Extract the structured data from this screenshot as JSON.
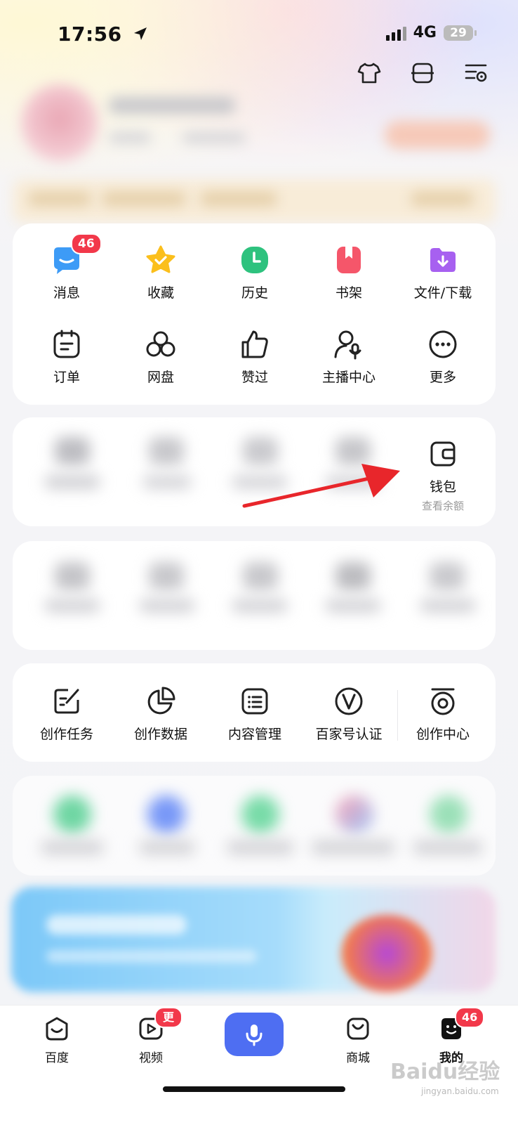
{
  "status_bar": {
    "time": "17:56",
    "network": "4G",
    "battery": "29"
  },
  "menu_grid": [
    {
      "label": "消息",
      "badge": "46"
    },
    {
      "label": "收藏"
    },
    {
      "label": "历史"
    },
    {
      "label": "书架"
    },
    {
      "label": "文件/下载"
    },
    {
      "label": "订单"
    },
    {
      "label": "网盘"
    },
    {
      "label": "赞过"
    },
    {
      "label": "主播中心"
    },
    {
      "label": "更多"
    }
  ],
  "wallet": {
    "label": "钱包",
    "sub": "查看余额"
  },
  "creator_tools": [
    {
      "label": "创作任务"
    },
    {
      "label": "创作数据"
    },
    {
      "label": "内容管理"
    },
    {
      "label": "百家号认证"
    },
    {
      "label": "创作中心"
    }
  ],
  "bottom_nav": [
    {
      "label": "百度"
    },
    {
      "label": "视频",
      "badge": "更新"
    },
    {
      "label": "商城"
    },
    {
      "label": "我的",
      "badge": "46"
    }
  ],
  "watermark": {
    "text": "Baidu经验",
    "sub": "jingyan.baidu.com"
  },
  "colors": {
    "accent": "#4e6ef2",
    "badge": "#f2384a",
    "arrow": "#e8262b"
  }
}
